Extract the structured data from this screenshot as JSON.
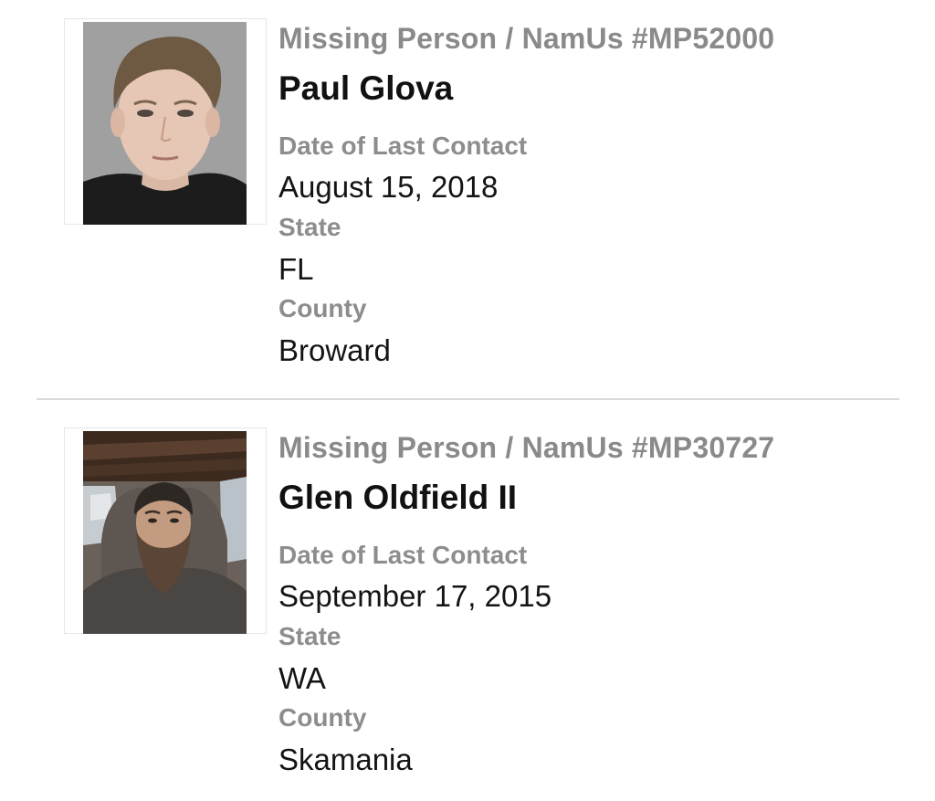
{
  "cases": [
    {
      "case_number": "Missing Person / NamUs #MP52000",
      "name": "Paul Glova",
      "date_label": "Date of Last Contact",
      "date": "August 15, 2018",
      "state_label": "State",
      "state": "FL",
      "county_label": "County",
      "county": "Broward",
      "photo_icon": "person-photo"
    },
    {
      "case_number": "Missing Person / NamUs #MP30727",
      "name": "Glen Oldfield II",
      "date_label": "Date of Last Contact",
      "date": "September 17, 2015",
      "state_label": "State",
      "state": "WA",
      "county_label": "County",
      "county": "Skamania",
      "photo_icon": "person-photo"
    }
  ],
  "colors": {
    "label_gray": "#8d8d8d",
    "value_black": "#141414",
    "divider": "#d9d9d9"
  }
}
